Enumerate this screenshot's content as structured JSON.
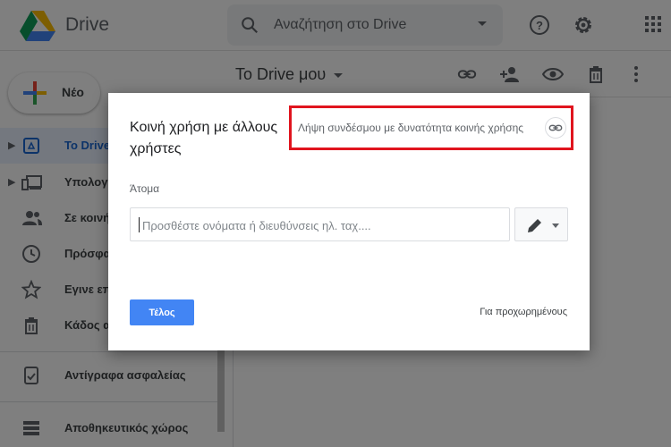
{
  "header": {
    "brand": "Drive",
    "search_placeholder": "Αναζήτηση στο Drive",
    "icons": [
      "drive-logo",
      "search-icon",
      "dropdown-icon",
      "help-icon",
      "gear-icon",
      "apps-icon"
    ]
  },
  "sidebar": {
    "new_label": "Νέο",
    "items": [
      {
        "label": "Το Drive",
        "icon": "drive-icon"
      },
      {
        "label": "Υπολογι",
        "icon": "computer-icon"
      },
      {
        "label": "Σε κοινή",
        "icon": "people-icon"
      },
      {
        "label": "Πρόσφα",
        "icon": "clock-icon"
      },
      {
        "label": "Εγινε επ",
        "icon": "star-icon"
      },
      {
        "label": "Κάδος α",
        "icon": "trash-icon"
      },
      {
        "label": "Αντίγραφα ασφαλείας",
        "icon": "backup-icon"
      },
      {
        "label": "Αποθηκευτικός χώρος",
        "icon": "storage-icon"
      }
    ]
  },
  "main": {
    "title": "Το Drive μου",
    "toolbar_icons": [
      "link-icon",
      "add-person-icon",
      "eye-icon",
      "trash-icon",
      "more-vert-icon"
    ]
  },
  "dialog": {
    "title": "Κοινή χρήση με άλλους χρήστες",
    "get_link_label": "Λήψη συνδέσμου με δυνατότητα κοινής χρήσης",
    "people_label": "Άτομα",
    "people_placeholder": "Προσθέστε ονόματα ή διευθύνσεις ηλ. ταχ....",
    "done_label": "Τέλος",
    "advanced_label": "Για προχωρημένους"
  },
  "colors": {
    "accent": "#4285f4",
    "highlight_box": "#e0141e",
    "active_nav_bg": "#e8f0fe"
  }
}
